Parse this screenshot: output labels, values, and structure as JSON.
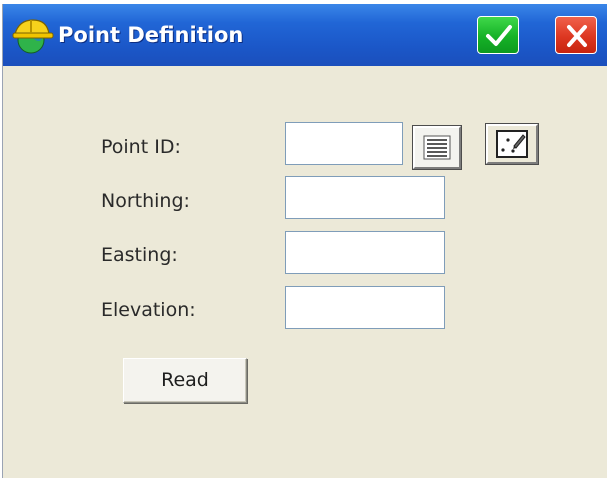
{
  "window": {
    "title": "Point Definition",
    "icons": {
      "app": "hardhat-globe-icon",
      "ok": "checkmark-icon",
      "close": "close-x-icon"
    },
    "colors": {
      "titlebar": "#1b57c8",
      "ok": "#16b227",
      "close": "#dd3721",
      "background": "#ece9d8"
    }
  },
  "form": {
    "point_id": {
      "label": "Point ID:",
      "value": ""
    },
    "northing": {
      "label": "Northing:",
      "value": ""
    },
    "easting": {
      "label": "Easting:",
      "value": ""
    },
    "elevation": {
      "label": "Elevation:",
      "value": ""
    },
    "list_button_icon": "list-icon",
    "map_button_icon": "map-pick-icon",
    "read_button": "Read"
  }
}
